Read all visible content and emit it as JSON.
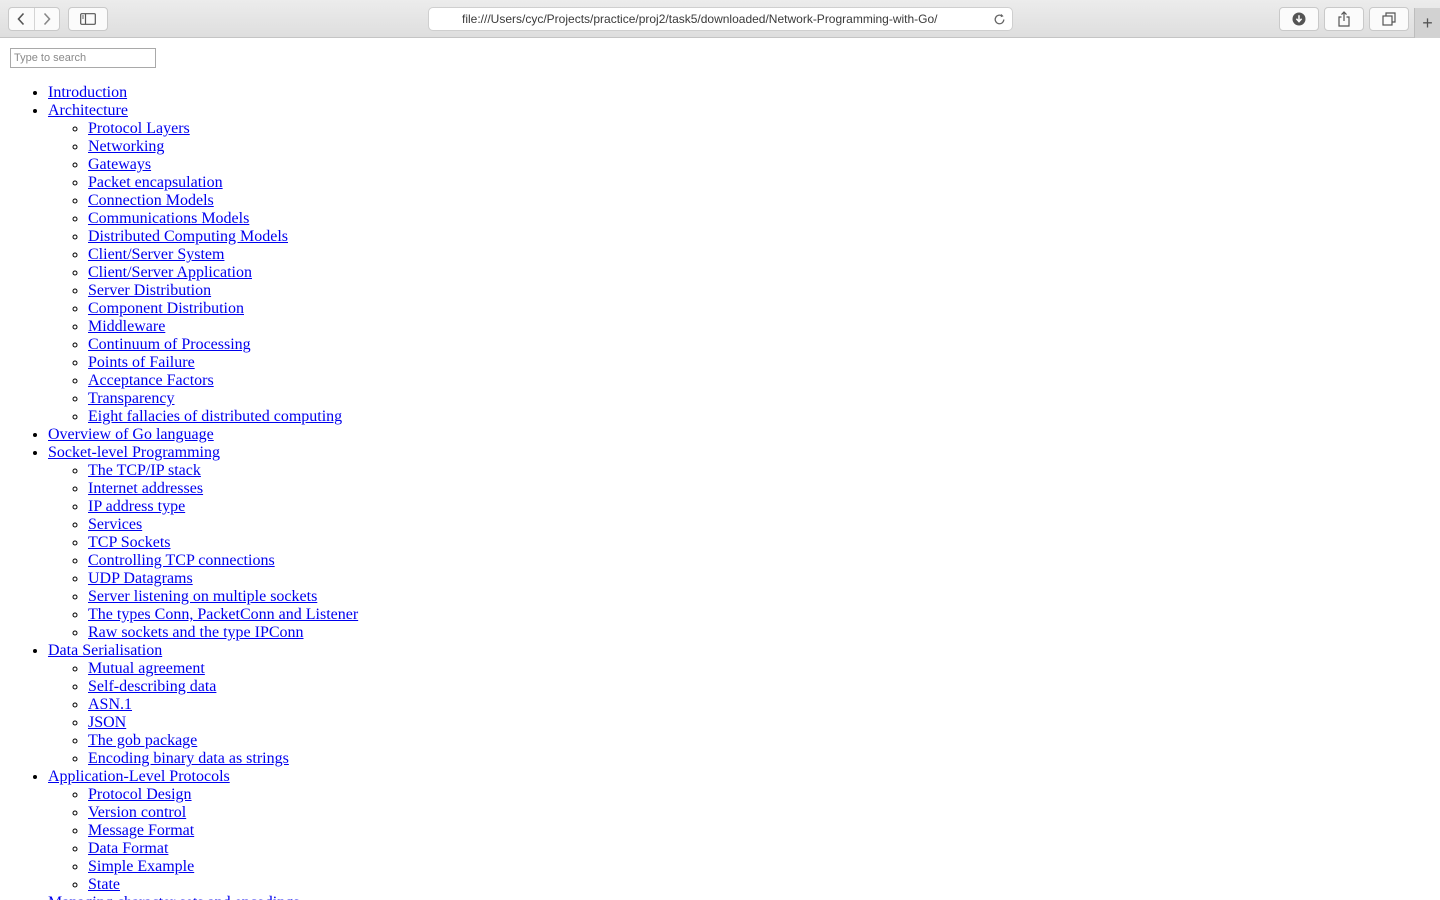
{
  "browser": {
    "url": "file:///Users/cyc/Projects/practice/proj2/task5/downloaded/Network-Programming-with-Go/",
    "new_tab_symbol": "+"
  },
  "search": {
    "placeholder": "Type to search"
  },
  "toc": [
    {
      "label": "Introduction",
      "children": []
    },
    {
      "label": "Architecture",
      "children": [
        "Protocol Layers",
        "Networking",
        "Gateways",
        "Packet encapsulation",
        "Connection Models",
        "Communications Models",
        "Distributed Computing Models",
        "Client/Server System",
        "Client/Server Application",
        "Server Distribution",
        "Component Distribution",
        "Middleware",
        "Continuum of Processing",
        "Points of Failure",
        "Acceptance Factors",
        "Transparency",
        "Eight fallacies of distributed computing"
      ]
    },
    {
      "label": "Overview of Go language",
      "children": []
    },
    {
      "label": "Socket-level Programming",
      "children": [
        "The TCP/IP stack",
        "Internet addresses",
        "IP address type",
        "Services",
        "TCP Sockets",
        "Controlling TCP connections",
        "UDP Datagrams",
        "Server listening on multiple sockets",
        "The types Conn, PacketConn and Listener",
        "Raw sockets and the type IPConn"
      ]
    },
    {
      "label": "Data Serialisation",
      "children": [
        "Mutual agreement",
        "Self-describing data",
        "ASN.1",
        "JSON",
        "The gob package",
        "Encoding binary data as strings"
      ]
    },
    {
      "label": "Application-Level Protocols",
      "children": [
        "Protocol Design",
        "Version control",
        "Message Format",
        "Data Format",
        "Simple Example",
        "State"
      ]
    },
    {
      "label": "Managing character sets and encodings",
      "children": []
    }
  ]
}
